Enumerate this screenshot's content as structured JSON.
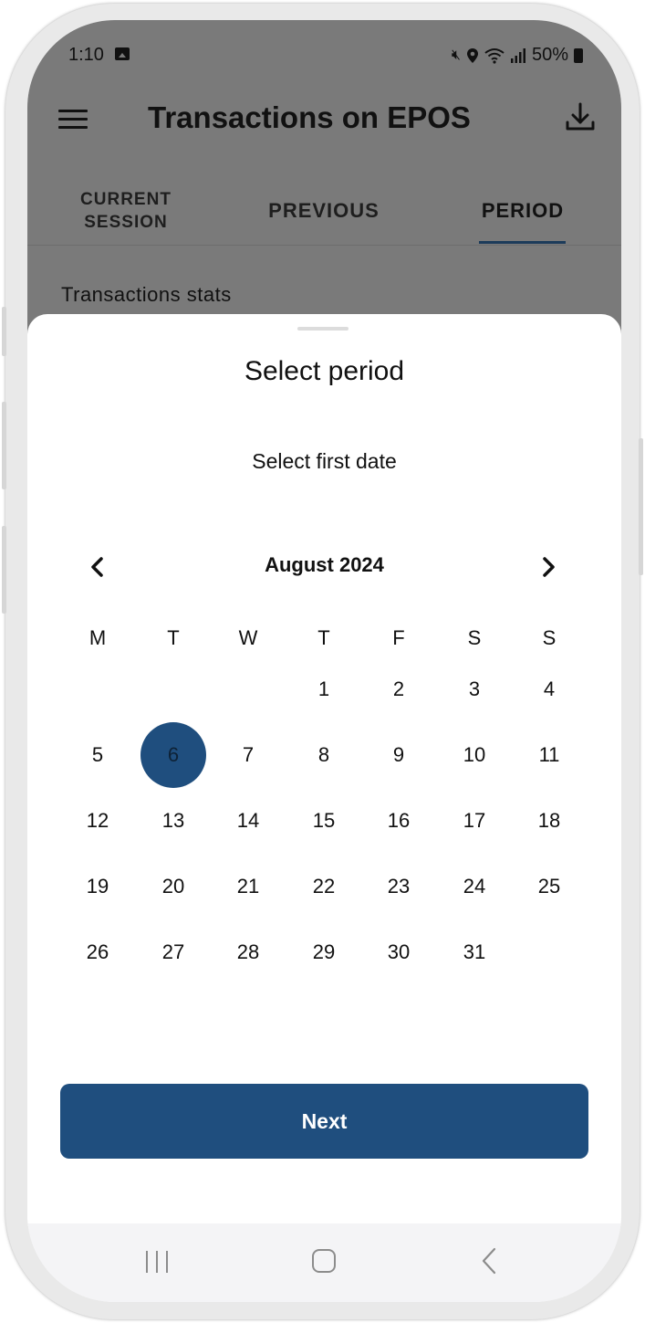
{
  "status_bar": {
    "time": "1:10",
    "battery": "50%",
    "icons": [
      "image-icon",
      "mute-icon",
      "location-icon",
      "wifi-icon",
      "signal-icon",
      "battery-icon"
    ]
  },
  "app_bar": {
    "title": "Transactions on EPOS",
    "menu_icon": "hamburger-menu-icon",
    "download_icon": "download-icon"
  },
  "tabs": [
    {
      "label_line1": "CURRENT",
      "label_line2": "SESSION",
      "selected": false
    },
    {
      "label": "PREVIOUS",
      "selected": false
    },
    {
      "label": "PERIOD",
      "selected": true
    }
  ],
  "section_label": "Transactions stats",
  "sheet": {
    "title": "Select period",
    "subtitle": "Select first date",
    "month_label": "August 2024",
    "prev_icon": "chevron-left-icon",
    "next_icon": "chevron-right-icon",
    "weekdays": [
      "M",
      "T",
      "W",
      "T",
      "F",
      "S",
      "S"
    ],
    "days": [
      "1",
      "2",
      "3",
      "4",
      "5",
      "6",
      "7",
      "8",
      "9",
      "10",
      "11",
      "12",
      "13",
      "14",
      "15",
      "16",
      "17",
      "18",
      "19",
      "20",
      "21",
      "22",
      "23",
      "24",
      "25",
      "26",
      "27",
      "28",
      "29",
      "30",
      "31"
    ],
    "first_weekday_index": 3,
    "selected_day": "6",
    "next_button": "Next"
  },
  "colors": {
    "accent": "#1f4e7e",
    "scrim": "#7a7a7a",
    "sheet_background": "#ffffff"
  }
}
